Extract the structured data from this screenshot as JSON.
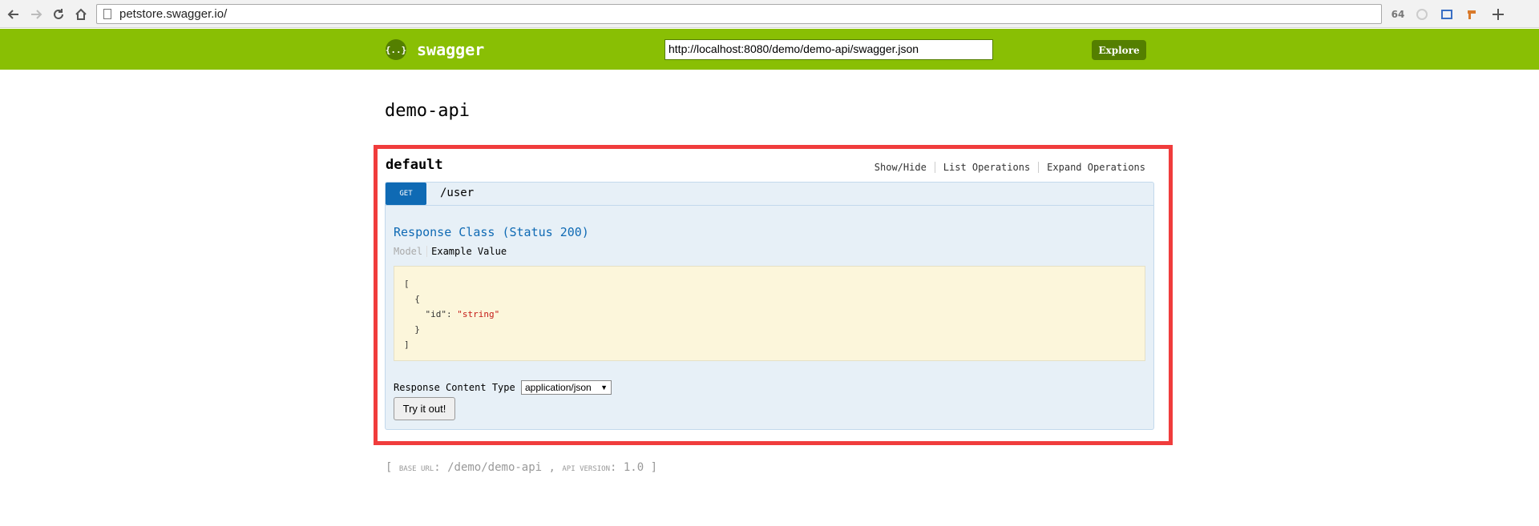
{
  "browser": {
    "url": "petstore.swagger.io/",
    "ext_badge": "64"
  },
  "header": {
    "logo_mark": "{..}",
    "logo_text": "swagger",
    "spec_url": "http://localhost:8080/demo/demo-api/swagger.json",
    "explore_label": "Explore"
  },
  "api": {
    "title": "demo-api"
  },
  "resource": {
    "name": "default",
    "ops": [
      "Show/Hide",
      "List Operations",
      "Expand Operations"
    ]
  },
  "operation": {
    "method": "GET",
    "path": "/user",
    "response_class": "Response Class (Status 200)",
    "tab_model": "Model",
    "tab_example": "Example Value",
    "example_lines": {
      "l1": "[",
      "l2": "  {",
      "l3_key": "    \"id\": ",
      "l3_val": "\"string\"",
      "l4": "  }",
      "l5": "]"
    },
    "content_type_label": "Response Content Type",
    "content_type_value": "application/json",
    "try_label": "Try it out!"
  },
  "footer": {
    "open": "[",
    "base_url_label": "BASE URL",
    "base_url_value": ": /demo/demo-api ,",
    "api_version_label": "API VERSION",
    "api_version_value": ": 1.0",
    "close": "]"
  }
}
